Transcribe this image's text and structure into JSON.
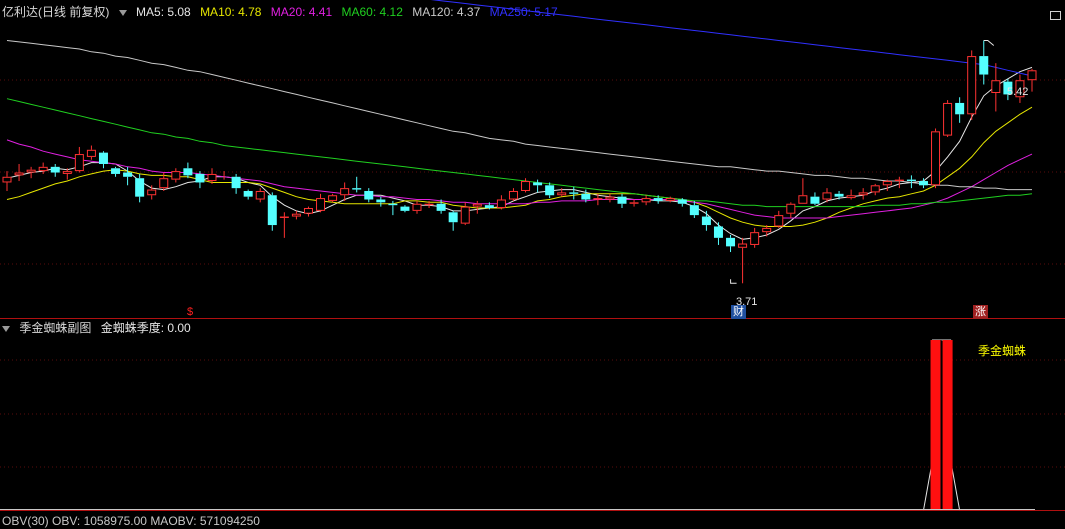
{
  "main": {
    "title": "亿利达(日线 前复权)",
    "ma": [
      {
        "label": "MA5: 5.08",
        "color": "#e6e6e6"
      },
      {
        "label": "MA10: 4.78",
        "color": "#e6e600"
      },
      {
        "label": "MA20: 4.41",
        "color": "#e020e0"
      },
      {
        "label": "MA60: 4.12",
        "color": "#20d020"
      },
      {
        "label": "MA120: 4.37",
        "color": "#c8c8c8"
      },
      {
        "label": "MA250: 5.17",
        "color": "#3030ff"
      }
    ],
    "high_label": "5.42",
    "low_label": "3.71",
    "markers": [
      {
        "text": "$",
        "color": "#ff2020"
      },
      {
        "text": "财",
        "color": "#ffffff"
      },
      {
        "text": "涨",
        "color": "#ffffff"
      }
    ]
  },
  "sub": {
    "title": "季金蜘蛛副图",
    "value_label": "金蜘蛛季度: 0.00",
    "annotation": "季金蜘蛛"
  },
  "obv": {
    "label": "OBV(30)  OBV: 1058975.00  MAOBV: 571094250"
  },
  "chart_data": {
    "type": "candlestick",
    "title": "亿利达(日线 前复权)",
    "ylim": [
      3.55,
      5.55
    ],
    "candles": [
      [
        4.42,
        4.5,
        4.36,
        4.46
      ],
      [
        4.47,
        4.55,
        4.43,
        4.49
      ],
      [
        4.49,
        4.53,
        4.45,
        4.51
      ],
      [
        4.5,
        4.56,
        4.48,
        4.53
      ],
      [
        4.53,
        4.55,
        4.46,
        4.49
      ],
      [
        4.48,
        4.52,
        4.44,
        4.5
      ],
      [
        4.5,
        4.67,
        4.49,
        4.62
      ],
      [
        4.6,
        4.68,
        4.58,
        4.65
      ],
      [
        4.63,
        4.64,
        4.52,
        4.55
      ],
      [
        4.52,
        4.53,
        4.46,
        4.48
      ],
      [
        4.49,
        4.53,
        4.4,
        4.46
      ],
      [
        4.45,
        4.48,
        4.28,
        4.32
      ],
      [
        4.33,
        4.4,
        4.3,
        4.37
      ],
      [
        4.38,
        4.49,
        4.36,
        4.45
      ],
      [
        4.44,
        4.52,
        4.42,
        4.5
      ],
      [
        4.52,
        4.56,
        4.45,
        4.47
      ],
      [
        4.48,
        4.5,
        4.38,
        4.42
      ],
      [
        4.43,
        4.52,
        4.41,
        4.48
      ],
      [
        4.47,
        4.5,
        4.44,
        4.47
      ],
      [
        4.46,
        4.48,
        4.34,
        4.38
      ],
      [
        4.36,
        4.37,
        4.3,
        4.32
      ],
      [
        4.3,
        4.38,
        4.28,
        4.36
      ],
      [
        4.33,
        4.35,
        4.08,
        4.12
      ],
      [
        4.17,
        4.21,
        4.03,
        4.18
      ],
      [
        4.18,
        4.22,
        4.16,
        4.2
      ],
      [
        4.2,
        4.25,
        4.18,
        4.24
      ],
      [
        4.22,
        4.34,
        4.21,
        4.31
      ],
      [
        4.29,
        4.34,
        4.28,
        4.33
      ],
      [
        4.33,
        4.42,
        4.29,
        4.38
      ],
      [
        4.38,
        4.46,
        4.35,
        4.37
      ],
      [
        4.36,
        4.38,
        4.28,
        4.3
      ],
      [
        4.3,
        4.32,
        4.25,
        4.28
      ],
      [
        4.27,
        4.29,
        4.19,
        4.26
      ],
      [
        4.25,
        4.26,
        4.21,
        4.22
      ],
      [
        4.22,
        4.29,
        4.2,
        4.27
      ],
      [
        4.26,
        4.29,
        4.24,
        4.27
      ],
      [
        4.27,
        4.3,
        4.2,
        4.22
      ],
      [
        4.21,
        4.22,
        4.08,
        4.14
      ],
      [
        4.13,
        4.28,
        4.12,
        4.25
      ],
      [
        4.25,
        4.29,
        4.2,
        4.27
      ],
      [
        4.26,
        4.28,
        4.23,
        4.24
      ],
      [
        4.24,
        4.33,
        4.23,
        4.3
      ],
      [
        4.3,
        4.38,
        4.29,
        4.36
      ],
      [
        4.36,
        4.45,
        4.35,
        4.43
      ],
      [
        4.42,
        4.44,
        4.35,
        4.4
      ],
      [
        4.4,
        4.42,
        4.31,
        4.33
      ],
      [
        4.33,
        4.38,
        4.32,
        4.35
      ],
      [
        4.35,
        4.39,
        4.3,
        4.34
      ],
      [
        4.34,
        4.37,
        4.28,
        4.3
      ],
      [
        4.3,
        4.34,
        4.26,
        4.31
      ],
      [
        4.3,
        4.34,
        4.28,
        4.32
      ],
      [
        4.32,
        4.34,
        4.24,
        4.27
      ],
      [
        4.27,
        4.3,
        4.25,
        4.28
      ],
      [
        4.28,
        4.33,
        4.26,
        4.31
      ],
      [
        4.31,
        4.33,
        4.27,
        4.29
      ],
      [
        4.29,
        4.32,
        4.28,
        4.31
      ],
      [
        4.3,
        4.31,
        4.25,
        4.27
      ],
      [
        4.26,
        4.29,
        4.17,
        4.19
      ],
      [
        4.18,
        4.22,
        4.08,
        4.12
      ],
      [
        4.11,
        4.14,
        3.98,
        4.03
      ],
      [
        4.03,
        4.05,
        3.93,
        3.97
      ],
      [
        3.96,
        4.03,
        3.71,
        3.99
      ],
      [
        3.98,
        4.1,
        3.96,
        4.07
      ],
      [
        4.07,
        4.12,
        4.04,
        4.1
      ],
      [
        4.11,
        4.22,
        4.1,
        4.19
      ],
      [
        4.2,
        4.28,
        4.17,
        4.27
      ],
      [
        4.27,
        4.45,
        4.27,
        4.33
      ],
      [
        4.32,
        4.35,
        4.26,
        4.27
      ],
      [
        4.3,
        4.38,
        4.28,
        4.35
      ],
      [
        4.34,
        4.36,
        4.3,
        4.32
      ],
      [
        4.31,
        4.37,
        4.3,
        4.33
      ],
      [
        4.33,
        4.38,
        4.3,
        4.35
      ],
      [
        4.35,
        4.41,
        4.33,
        4.4
      ],
      [
        4.4,
        4.44,
        4.36,
        4.43
      ],
      [
        4.43,
        4.46,
        4.38,
        4.44
      ],
      [
        4.44,
        4.47,
        4.38,
        4.43
      ],
      [
        4.43,
        4.45,
        4.38,
        4.4
      ],
      [
        4.4,
        4.8,
        4.38,
        4.78
      ],
      [
        4.75,
        5.0,
        4.74,
        4.98
      ],
      [
        4.98,
        5.02,
        4.84,
        4.9
      ],
      [
        4.9,
        5.35,
        4.86,
        5.31
      ],
      [
        5.31,
        5.42,
        5.11,
        5.18
      ],
      [
        5.05,
        5.26,
        4.92,
        5.14
      ],
      [
        5.13,
        5.15,
        5.0,
        5.04
      ],
      [
        5.02,
        5.18,
        4.98,
        5.14
      ],
      [
        5.14,
        5.22,
        5.06,
        5.21
      ]
    ],
    "series": [
      {
        "name": "MA5",
        "color": "#e6e6e6",
        "values": [
          4.45,
          4.47,
          4.49,
          4.5,
          4.52,
          4.51,
          4.53,
          4.56,
          4.56,
          4.55,
          4.5,
          4.43,
          4.38,
          4.37,
          4.39,
          4.42,
          4.43,
          4.46,
          4.46,
          4.45,
          4.42,
          4.4,
          4.32,
          4.26,
          4.22,
          4.2,
          4.22,
          4.26,
          4.3,
          4.33,
          4.33,
          4.33,
          4.31,
          4.29,
          4.26,
          4.26,
          4.25,
          4.22,
          4.22,
          4.23,
          4.24,
          4.25,
          4.29,
          4.32,
          4.35,
          4.36,
          4.37,
          4.37,
          4.35,
          4.33,
          4.32,
          4.31,
          4.3,
          4.3,
          4.29,
          4.29,
          4.28,
          4.25,
          4.2,
          4.12,
          4.06,
          4.02,
          4.03,
          4.05,
          4.09,
          4.15,
          4.22,
          4.25,
          4.29,
          4.31,
          4.32,
          4.33,
          4.36,
          4.38,
          4.41,
          4.42,
          4.43,
          4.5,
          4.6,
          4.71,
          4.88,
          5.03,
          5.1,
          5.15,
          5.2,
          5.23
        ]
      },
      {
        "name": "MA10",
        "color": "#e6e600",
        "values": [
          4.3,
          4.32,
          4.35,
          4.38,
          4.41,
          4.43,
          4.46,
          4.48,
          4.5,
          4.51,
          4.5,
          4.48,
          4.47,
          4.47,
          4.46,
          4.46,
          4.44,
          4.42,
          4.42,
          4.42,
          4.42,
          4.41,
          4.38,
          4.35,
          4.32,
          4.3,
          4.29,
          4.28,
          4.27,
          4.27,
          4.27,
          4.27,
          4.27,
          4.29,
          4.29,
          4.28,
          4.28,
          4.26,
          4.25,
          4.24,
          4.24,
          4.24,
          4.25,
          4.26,
          4.29,
          4.3,
          4.32,
          4.33,
          4.34,
          4.34,
          4.34,
          4.34,
          4.34,
          4.33,
          4.32,
          4.31,
          4.3,
          4.28,
          4.25,
          4.21,
          4.17,
          4.14,
          4.12,
          4.11,
          4.11,
          4.11,
          4.12,
          4.14,
          4.17,
          4.21,
          4.24,
          4.27,
          4.29,
          4.31,
          4.32,
          4.34,
          4.36,
          4.4,
          4.46,
          4.52,
          4.6,
          4.7,
          4.78,
          4.84,
          4.9,
          4.95
        ]
      },
      {
        "name": "MA20",
        "color": "#e020e0",
        "values": [
          4.72,
          4.69,
          4.67,
          4.64,
          4.62,
          4.6,
          4.58,
          4.57,
          4.56,
          4.55,
          4.53,
          4.52,
          4.5,
          4.49,
          4.49,
          4.49,
          4.48,
          4.47,
          4.46,
          4.45,
          4.44,
          4.43,
          4.41,
          4.39,
          4.38,
          4.37,
          4.36,
          4.35,
          4.34,
          4.33,
          4.33,
          4.32,
          4.32,
          4.31,
          4.3,
          4.3,
          4.29,
          4.28,
          4.28,
          4.27,
          4.27,
          4.27,
          4.27,
          4.27,
          4.28,
          4.28,
          4.29,
          4.29,
          4.29,
          4.3,
          4.3,
          4.3,
          4.3,
          4.3,
          4.3,
          4.3,
          4.29,
          4.28,
          4.27,
          4.25,
          4.23,
          4.21,
          4.19,
          4.18,
          4.17,
          4.17,
          4.17,
          4.17,
          4.17,
          4.18,
          4.19,
          4.2,
          4.21,
          4.22,
          4.23,
          4.24,
          4.26,
          4.28,
          4.31,
          4.35,
          4.39,
          4.44,
          4.49,
          4.54,
          4.58,
          4.62
        ]
      },
      {
        "name": "MA60",
        "color": "#20d020",
        "values": [
          5.01,
          4.99,
          4.97,
          4.95,
          4.93,
          4.91,
          4.89,
          4.87,
          4.85,
          4.83,
          4.81,
          4.79,
          4.77,
          4.76,
          4.74,
          4.73,
          4.71,
          4.7,
          4.68,
          4.67,
          4.66,
          4.65,
          4.64,
          4.63,
          4.62,
          4.61,
          4.6,
          4.59,
          4.58,
          4.57,
          4.56,
          4.55,
          4.54,
          4.53,
          4.52,
          4.51,
          4.5,
          4.49,
          4.48,
          4.47,
          4.46,
          4.45,
          4.44,
          4.43,
          4.42,
          4.41,
          4.4,
          4.39,
          4.38,
          4.37,
          4.36,
          4.35,
          4.34,
          4.33,
          4.32,
          4.31,
          4.3,
          4.29,
          4.29,
          4.28,
          4.27,
          4.26,
          4.26,
          4.25,
          4.25,
          4.25,
          4.25,
          4.25,
          4.25,
          4.25,
          4.25,
          4.25,
          4.26,
          4.26,
          4.26,
          4.27,
          4.27,
          4.28,
          4.28,
          4.29,
          4.3,
          4.31,
          4.32,
          4.33,
          4.33,
          4.34
        ]
      },
      {
        "name": "MA120",
        "color": "#c8c8c8",
        "values": [
          5.42,
          5.41,
          5.4,
          5.39,
          5.38,
          5.37,
          5.36,
          5.34,
          5.33,
          5.31,
          5.3,
          5.28,
          5.26,
          5.25,
          5.23,
          5.21,
          5.2,
          5.18,
          5.16,
          5.14,
          5.12,
          5.1,
          5.08,
          5.06,
          5.04,
          5.02,
          5.0,
          4.98,
          4.96,
          4.94,
          4.92,
          4.9,
          4.88,
          4.86,
          4.84,
          4.82,
          4.8,
          4.78,
          4.77,
          4.75,
          4.73,
          4.72,
          4.71,
          4.69,
          4.68,
          4.67,
          4.66,
          4.65,
          4.64,
          4.63,
          4.62,
          4.61,
          4.6,
          4.59,
          4.58,
          4.57,
          4.56,
          4.55,
          4.54,
          4.53,
          4.53,
          4.52,
          4.51,
          4.5,
          4.5,
          4.49,
          4.48,
          4.47,
          4.47,
          4.46,
          4.45,
          4.45,
          4.44,
          4.43,
          4.43,
          4.42,
          4.41,
          4.4,
          4.4,
          4.39,
          4.39,
          4.38,
          4.38,
          4.37,
          4.37,
          4.37
        ]
      },
      {
        "name": "MA250",
        "color": "#3030ff",
        "values": [
          6.06,
          6.05,
          6.04,
          6.03,
          6.02,
          6.01,
          6.0,
          5.99,
          5.98,
          5.97,
          5.96,
          5.95,
          5.94,
          5.93,
          5.92,
          5.91,
          5.9,
          5.89,
          5.88,
          5.87,
          5.86,
          5.85,
          5.84,
          5.83,
          5.82,
          5.81,
          5.8,
          5.79,
          5.78,
          5.77,
          5.76,
          5.75,
          5.74,
          5.73,
          5.72,
          5.71,
          5.7,
          5.69,
          5.68,
          5.67,
          5.66,
          5.65,
          5.64,
          5.63,
          5.62,
          5.61,
          5.6,
          5.59,
          5.58,
          5.57,
          5.56,
          5.55,
          5.54,
          5.53,
          5.52,
          5.51,
          5.5,
          5.49,
          5.48,
          5.47,
          5.46,
          5.45,
          5.44,
          5.43,
          5.42,
          5.41,
          5.4,
          5.39,
          5.38,
          5.37,
          5.36,
          5.35,
          5.34,
          5.33,
          5.32,
          5.31,
          5.3,
          5.29,
          5.28,
          5.27,
          5.26,
          5.25,
          5.23,
          5.21,
          5.19,
          5.17
        ]
      }
    ],
    "sub_bars": {
      "indices": [
        77,
        78
      ],
      "color": "#ff1010"
    }
  }
}
